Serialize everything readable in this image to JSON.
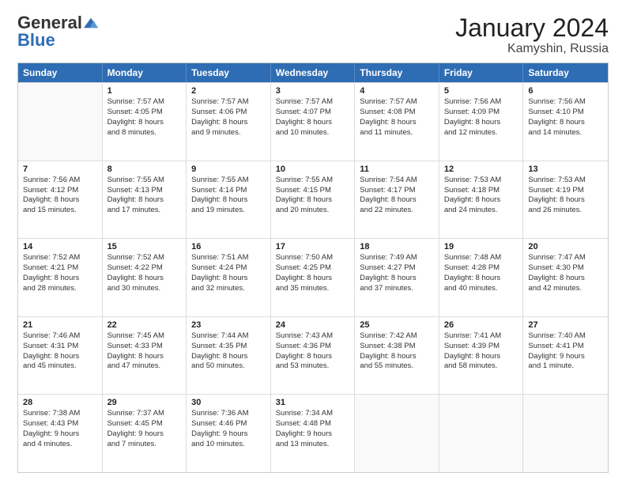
{
  "header": {
    "logo_general": "General",
    "logo_blue": "Blue",
    "month_title": "January 2024",
    "location": "Kamyshin, Russia"
  },
  "days_of_week": [
    "Sunday",
    "Monday",
    "Tuesday",
    "Wednesday",
    "Thursday",
    "Friday",
    "Saturday"
  ],
  "weeks": [
    [
      {
        "day": "",
        "empty": true
      },
      {
        "day": "1",
        "sunrise": "Sunrise: 7:57 AM",
        "sunset": "Sunset: 4:05 PM",
        "daylight": "Daylight: 8 hours and 8 minutes."
      },
      {
        "day": "2",
        "sunrise": "Sunrise: 7:57 AM",
        "sunset": "Sunset: 4:06 PM",
        "daylight": "Daylight: 8 hours and 9 minutes."
      },
      {
        "day": "3",
        "sunrise": "Sunrise: 7:57 AM",
        "sunset": "Sunset: 4:07 PM",
        "daylight": "Daylight: 8 hours and 10 minutes."
      },
      {
        "day": "4",
        "sunrise": "Sunrise: 7:57 AM",
        "sunset": "Sunset: 4:08 PM",
        "daylight": "Daylight: 8 hours and 11 minutes."
      },
      {
        "day": "5",
        "sunrise": "Sunrise: 7:56 AM",
        "sunset": "Sunset: 4:09 PM",
        "daylight": "Daylight: 8 hours and 12 minutes."
      },
      {
        "day": "6",
        "sunrise": "Sunrise: 7:56 AM",
        "sunset": "Sunset: 4:10 PM",
        "daylight": "Daylight: 8 hours and 14 minutes."
      }
    ],
    [
      {
        "day": "7",
        "sunrise": "Sunrise: 7:56 AM",
        "sunset": "Sunset: 4:12 PM",
        "daylight": "Daylight: 8 hours and 15 minutes."
      },
      {
        "day": "8",
        "sunrise": "Sunrise: 7:55 AM",
        "sunset": "Sunset: 4:13 PM",
        "daylight": "Daylight: 8 hours and 17 minutes."
      },
      {
        "day": "9",
        "sunrise": "Sunrise: 7:55 AM",
        "sunset": "Sunset: 4:14 PM",
        "daylight": "Daylight: 8 hours and 19 minutes."
      },
      {
        "day": "10",
        "sunrise": "Sunrise: 7:55 AM",
        "sunset": "Sunset: 4:15 PM",
        "daylight": "Daylight: 8 hours and 20 minutes."
      },
      {
        "day": "11",
        "sunrise": "Sunrise: 7:54 AM",
        "sunset": "Sunset: 4:17 PM",
        "daylight": "Daylight: 8 hours and 22 minutes."
      },
      {
        "day": "12",
        "sunrise": "Sunrise: 7:53 AM",
        "sunset": "Sunset: 4:18 PM",
        "daylight": "Daylight: 8 hours and 24 minutes."
      },
      {
        "day": "13",
        "sunrise": "Sunrise: 7:53 AM",
        "sunset": "Sunset: 4:19 PM",
        "daylight": "Daylight: 8 hours and 26 minutes."
      }
    ],
    [
      {
        "day": "14",
        "sunrise": "Sunrise: 7:52 AM",
        "sunset": "Sunset: 4:21 PM",
        "daylight": "Daylight: 8 hours and 28 minutes."
      },
      {
        "day": "15",
        "sunrise": "Sunrise: 7:52 AM",
        "sunset": "Sunset: 4:22 PM",
        "daylight": "Daylight: 8 hours and 30 minutes."
      },
      {
        "day": "16",
        "sunrise": "Sunrise: 7:51 AM",
        "sunset": "Sunset: 4:24 PM",
        "daylight": "Daylight: 8 hours and 32 minutes."
      },
      {
        "day": "17",
        "sunrise": "Sunrise: 7:50 AM",
        "sunset": "Sunset: 4:25 PM",
        "daylight": "Daylight: 8 hours and 35 minutes."
      },
      {
        "day": "18",
        "sunrise": "Sunrise: 7:49 AM",
        "sunset": "Sunset: 4:27 PM",
        "daylight": "Daylight: 8 hours and 37 minutes."
      },
      {
        "day": "19",
        "sunrise": "Sunrise: 7:48 AM",
        "sunset": "Sunset: 4:28 PM",
        "daylight": "Daylight: 8 hours and 40 minutes."
      },
      {
        "day": "20",
        "sunrise": "Sunrise: 7:47 AM",
        "sunset": "Sunset: 4:30 PM",
        "daylight": "Daylight: 8 hours and 42 minutes."
      }
    ],
    [
      {
        "day": "21",
        "sunrise": "Sunrise: 7:46 AM",
        "sunset": "Sunset: 4:31 PM",
        "daylight": "Daylight: 8 hours and 45 minutes."
      },
      {
        "day": "22",
        "sunrise": "Sunrise: 7:45 AM",
        "sunset": "Sunset: 4:33 PM",
        "daylight": "Daylight: 8 hours and 47 minutes."
      },
      {
        "day": "23",
        "sunrise": "Sunrise: 7:44 AM",
        "sunset": "Sunset: 4:35 PM",
        "daylight": "Daylight: 8 hours and 50 minutes."
      },
      {
        "day": "24",
        "sunrise": "Sunrise: 7:43 AM",
        "sunset": "Sunset: 4:36 PM",
        "daylight": "Daylight: 8 hours and 53 minutes."
      },
      {
        "day": "25",
        "sunrise": "Sunrise: 7:42 AM",
        "sunset": "Sunset: 4:38 PM",
        "daylight": "Daylight: 8 hours and 55 minutes."
      },
      {
        "day": "26",
        "sunrise": "Sunrise: 7:41 AM",
        "sunset": "Sunset: 4:39 PM",
        "daylight": "Daylight: 8 hours and 58 minutes."
      },
      {
        "day": "27",
        "sunrise": "Sunrise: 7:40 AM",
        "sunset": "Sunset: 4:41 PM",
        "daylight": "Daylight: 9 hours and 1 minute."
      }
    ],
    [
      {
        "day": "28",
        "sunrise": "Sunrise: 7:38 AM",
        "sunset": "Sunset: 4:43 PM",
        "daylight": "Daylight: 9 hours and 4 minutes."
      },
      {
        "day": "29",
        "sunrise": "Sunrise: 7:37 AM",
        "sunset": "Sunset: 4:45 PM",
        "daylight": "Daylight: 9 hours and 7 minutes."
      },
      {
        "day": "30",
        "sunrise": "Sunrise: 7:36 AM",
        "sunset": "Sunset: 4:46 PM",
        "daylight": "Daylight: 9 hours and 10 minutes."
      },
      {
        "day": "31",
        "sunrise": "Sunrise: 7:34 AM",
        "sunset": "Sunset: 4:48 PM",
        "daylight": "Daylight: 9 hours and 13 minutes."
      },
      {
        "day": "",
        "empty": true
      },
      {
        "day": "",
        "empty": true
      },
      {
        "day": "",
        "empty": true
      }
    ]
  ]
}
